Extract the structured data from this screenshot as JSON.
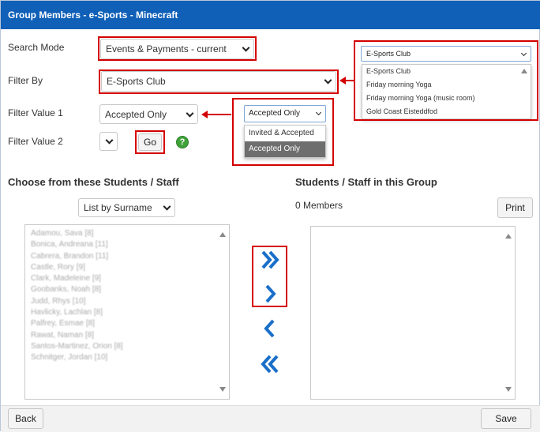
{
  "window": {
    "title": "Group Members - e-Sports - Minecraft"
  },
  "filters": {
    "search_mode_label": "Search Mode",
    "search_mode_value": "Events & Payments - current",
    "filter_by_label": "Filter By",
    "filter_by_value": "E-Sports Club",
    "filter_value1_label": "Filter Value 1",
    "filter_value1_value": "Accepted Only",
    "filter_value2_label": "Filter Value 2",
    "go_label": "Go",
    "help_icon_text": "?"
  },
  "filter_by_dropdown": {
    "selected": "E-Sports Club",
    "options": [
      "E-Sports Club",
      "Friday morning Yoga",
      "Friday morning Yoga (music room)",
      "Gold Coast Eisteddfod"
    ]
  },
  "filter_value_dropdown": {
    "selected": "Accepted Only",
    "options": [
      "Invited & Accepted",
      "Accepted Only"
    ],
    "highlighted_index": 1
  },
  "left_panel": {
    "heading": "Choose from these Students / Staff",
    "sort_value": "List by Surname",
    "students": [
      "Adamou, Sava [8]",
      "Bonica, Andreana [11]",
      "Cabrera, Brandon [11]",
      "Castle, Rory [9]",
      "Clark, Madeleine [9]",
      "Goobanks, Noah [8]",
      "Judd, Rhys [10]",
      "Havlicky, Lachlan [8]",
      "Palfrey, Esmae [8]",
      "Rawat, Naman [8]",
      "Santos-Martinez, Orion [8]",
      "Schnitger, Jordan [10]"
    ]
  },
  "right_panel": {
    "heading": "Students / Staff in this Group",
    "count_text": "0 Members",
    "print_label": "Print"
  },
  "footer": {
    "back_label": "Back",
    "save_label": "Save"
  },
  "colors": {
    "titlebar": "#1060b8",
    "accent": "#1a6fc9",
    "highlight": "#d40000",
    "help": "#3fa33a"
  }
}
